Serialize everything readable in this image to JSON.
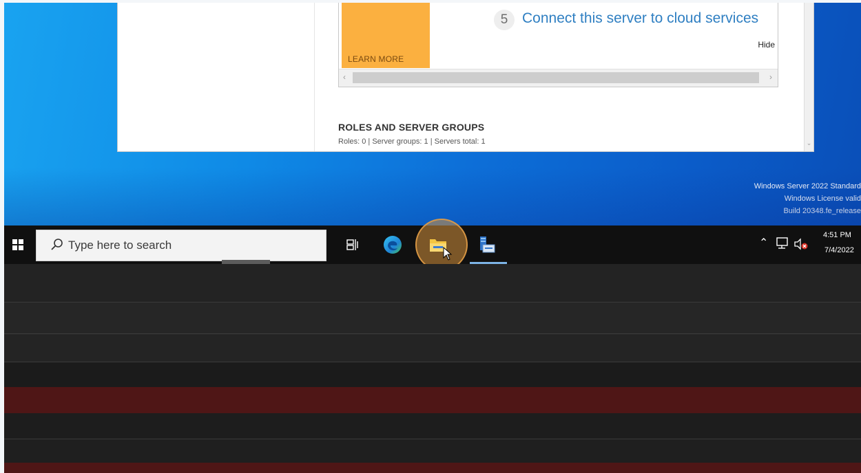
{
  "server_manager": {
    "welcome": {
      "learn_more": "LEARN MORE",
      "step_number": "5",
      "step_text": "Connect this server to cloud services",
      "hide": "Hide"
    },
    "roles": {
      "title": "ROLES AND SERVER GROUPS",
      "stats": "Roles: 0  |  Server groups: 1  |  Servers total: 1"
    }
  },
  "watermark": {
    "line1": "Windows Server 2022 Standard",
    "line2": "Windows License valid",
    "line3": "Build 20348.fe_release"
  },
  "taskbar": {
    "search_placeholder": "Type here to search",
    "icons": [
      "windows-icon",
      "search-icon",
      "task-view-icon",
      "edge-icon",
      "file-explorer-icon",
      "server-manager-icon"
    ],
    "clock": {
      "time": "4:51 PM",
      "date": "7/4/2022"
    },
    "highlight_color": "#d6923c"
  },
  "colors": {
    "desktop": "#0d6fd8",
    "accent_orange": "#fbb040",
    "link_blue": "#2f7fc2",
    "band_red": "#4f1616"
  }
}
